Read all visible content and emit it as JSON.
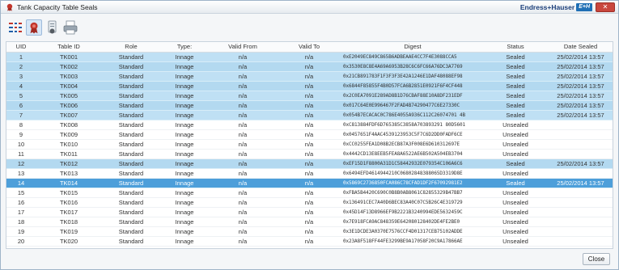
{
  "window": {
    "title": "Tank Capacity Table Seals",
    "brand_name": "Endress+Hauser",
    "brand_badge": "E+H",
    "close_x": "✕"
  },
  "toolbar": {
    "icons": [
      "list-view-icon",
      "seal-icon",
      "audit-icon",
      "print-icon"
    ]
  },
  "table": {
    "columns": [
      "UID",
      "Table ID",
      "Role",
      "Type:",
      "Valid From",
      "Valid To",
      "Digest",
      "Status",
      "Date Sealed"
    ],
    "rows": [
      {
        "uid": "1",
        "table_id": "TK001",
        "role": "Standard",
        "type": "Innage",
        "valid_from": "n/a",
        "valid_to": "n/a",
        "digest": "0xE2049EC849C865B6ADBEAAE4CC7F4E3088CCA5",
        "status": "Sealed",
        "date_sealed": "25/02/2014 13:57"
      },
      {
        "uid": "2",
        "table_id": "TK002",
        "role": "Standard",
        "type": "Innage",
        "valid_from": "n/a",
        "valid_to": "n/a",
        "digest": "0x3530E8C8E4A69A6953B28C6C6FC66A76DC3A7769",
        "status": "Sealed",
        "date_sealed": "25/02/2014 13:57"
      },
      {
        "uid": "3",
        "table_id": "TK003",
        "role": "Standard",
        "type": "Innage",
        "valid_from": "n/a",
        "valid_to": "n/a",
        "digest": "0x21CB891783F1F3F3F3E42A1246E1DAF48088EF98",
        "status": "Sealed",
        "date_sealed": "25/02/2014 13:57"
      },
      {
        "uid": "4",
        "table_id": "TK004",
        "role": "Standard",
        "type": "Innage",
        "valid_from": "n/a",
        "valid_to": "n/a",
        "digest": "0x6844F85855F4B0D57FCA6B2851E0921F6F4CF448",
        "status": "Sealed",
        "date_sealed": "25/02/2014 13:57"
      },
      {
        "uid": "5",
        "table_id": "TK005",
        "role": "Standard",
        "type": "Innage",
        "valid_from": "n/a",
        "valid_to": "n/a",
        "digest": "0x2C0EA7091E289AD8B1D76CBAF88E10A8DF231EDF",
        "status": "Sealed",
        "date_sealed": "25/02/2014 13:57"
      },
      {
        "uid": "6",
        "table_id": "TK006",
        "role": "Standard",
        "type": "Innage",
        "valid_from": "n/a",
        "valid_to": "n/a",
        "digest": "0x017C64E0E996467F2FAD4B74290477C6E27330C",
        "status": "Sealed",
        "date_sealed": "25/02/2014 13:57"
      },
      {
        "uid": "7",
        "table_id": "TK007",
        "role": "Standard",
        "type": "Innage",
        "valid_from": "n/a",
        "valid_to": "n/a",
        "digest": "0x054B7ECACAC0C786E4055A936C112C26074701 4B",
        "status": "Sealed",
        "date_sealed": "25/02/2014 13:57"
      },
      {
        "uid": "8",
        "table_id": "TK008",
        "role": "Standard",
        "type": "Innage",
        "valid_from": "n/a",
        "valid_to": "n/a",
        "digest": "0xC813884FDF6D765385C3858A703893291 80D5601",
        "status": "Unsealed",
        "date_sealed": ""
      },
      {
        "uid": "9",
        "table_id": "TK009",
        "role": "Standard",
        "type": "Innage",
        "valid_from": "n/a",
        "valid_to": "n/a",
        "digest": "0x0457651F4AAC4539123953C5F7C6D2DD0FADF6CE",
        "status": "Unsealed",
        "date_sealed": ""
      },
      {
        "uid": "10",
        "table_id": "TK010",
        "role": "Standard",
        "type": "Innage",
        "valid_from": "n/a",
        "valid_to": "n/a",
        "digest": "0xCC0255FEA1D08B2ECB87A3F008E6D610312697E",
        "status": "Unsealed",
        "date_sealed": ""
      },
      {
        "uid": "11",
        "table_id": "TK011",
        "role": "Standard",
        "type": "Innage",
        "valid_from": "n/a",
        "valid_to": "n/a",
        "digest": "0x4442CD13E8EEB5FEA8A6522AE6B502A504EB3704",
        "status": "Unsealed",
        "date_sealed": ""
      },
      {
        "uid": "12",
        "table_id": "TK012",
        "role": "Standard",
        "type": "Innage",
        "valid_from": "n/a",
        "valid_to": "n/a",
        "digest": "0xEF15D1F8800A31D1C58442932E079354C106A6C6",
        "status": "Sealed",
        "date_sealed": "25/02/2014 13:57"
      },
      {
        "uid": "13",
        "table_id": "TK013",
        "role": "Standard",
        "type": "Innage",
        "valid_from": "n/a",
        "valid_to": "n/a",
        "digest": "0x6494EFD4614944210C06802848388065D3319D8E",
        "status": "Unsealed",
        "date_sealed": ""
      },
      {
        "uid": "14",
        "table_id": "TK014",
        "role": "Standard",
        "type": "Innage",
        "valid_from": "n/a",
        "valid_to": "n/a",
        "digest": "0x5869C2736850FCA086C78CFAD1DF2F67092981E2",
        "status": "Sealed",
        "date_sealed": "25/02/2014 13:57"
      },
      {
        "uid": "15",
        "table_id": "TK015",
        "role": "Standard",
        "type": "Innage",
        "valid_from": "n/a",
        "valid_to": "n/a",
        "digest": "0xFBA5B4420C690C0B8B0AB8061C82855329B47BB7",
        "status": "Unsealed",
        "date_sealed": ""
      },
      {
        "uid": "16",
        "table_id": "TK016",
        "role": "Standard",
        "type": "Innage",
        "valid_from": "n/a",
        "valid_to": "n/a",
        "digest": "0x136491CEC7A40D6BEC83A40C07C5B26C4E319729",
        "status": "Unsealed",
        "date_sealed": ""
      },
      {
        "uid": "17",
        "table_id": "TK017",
        "role": "Standard",
        "type": "Innage",
        "valid_from": "n/a",
        "valid_to": "n/a",
        "digest": "0x45D14F13D8966EF9B2221B3240994EDE5632459C",
        "status": "Unsealed",
        "date_sealed": ""
      },
      {
        "uid": "18",
        "table_id": "TK018",
        "role": "Standard",
        "type": "Innage",
        "valid_from": "n/a",
        "valid_to": "n/a",
        "digest": "0x7E918FCA9AC848359E642080128402DE4FE2BE0",
        "status": "Unsealed",
        "date_sealed": ""
      },
      {
        "uid": "19",
        "table_id": "TK019",
        "role": "Standard",
        "type": "Innage",
        "valid_from": "n/a",
        "valid_to": "n/a",
        "digest": "0x3E1DCDE3A0370E7576CCF4D01317CEB75102ADDE",
        "status": "Unsealed",
        "date_sealed": ""
      },
      {
        "uid": "20",
        "table_id": "TK020",
        "role": "Standard",
        "type": "Innage",
        "valid_from": "n/a",
        "valid_to": "n/a",
        "digest": "0x23A8F518FF44FE3299BE9A17058F20C9A17866AE",
        "status": "Unsealed",
        "date_sealed": ""
      }
    ],
    "selected_uid": "14",
    "colors": {
      "sealed": "#bfe0f4",
      "selected": "#4d9fda"
    }
  },
  "footer": {
    "close_label": "Close"
  }
}
